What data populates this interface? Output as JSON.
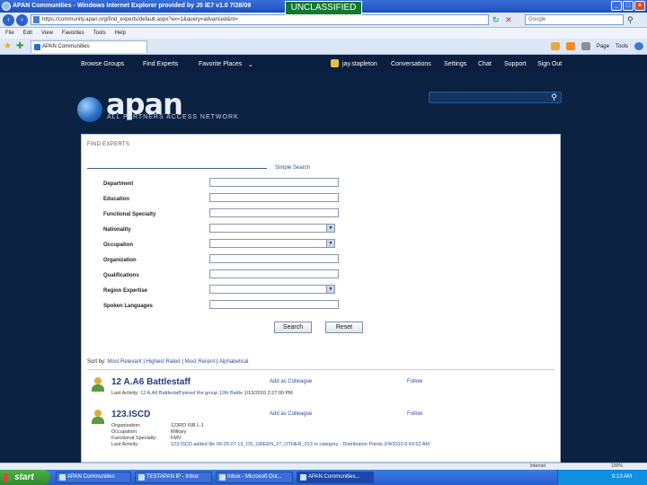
{
  "browser": {
    "title": "APAN Communities - Windows Internet Explorer provided by J5 IE7 v1.0 7/28/09",
    "classification": "UNCLASSIFIED",
    "address": "https://community.apan.org/find_experts/default.aspx?ex=1&query=advanced&nt=",
    "search_placeholder": "Google",
    "menu": [
      "File",
      "Edit",
      "View",
      "Favorites",
      "Tools",
      "Help"
    ],
    "tab_label": "APAN Communities",
    "cmd_items": [
      "Page",
      "Tools"
    ]
  },
  "site": {
    "nav": {
      "browse_groups": "Browse Groups",
      "find_experts": "Find Experts",
      "favorite_places": "Favorite Places",
      "user": "jay.stapleton",
      "conversations": "Conversations",
      "settings": "Settings",
      "chat": "Chat",
      "support": "Support",
      "sign_out": "Sign Out"
    },
    "logo": "apan",
    "logo_tagline": "ALL PARTNERS ACCESS NETWORK"
  },
  "find_experts": {
    "title": "FIND EXPERTS",
    "simple_search": "Simple Search",
    "fields": [
      {
        "label": "Department",
        "type": "text"
      },
      {
        "label": "Education",
        "type": "text"
      },
      {
        "label": "Functional Specialty",
        "type": "text"
      },
      {
        "label": "Nationality",
        "type": "select"
      },
      {
        "label": "Occupation",
        "type": "select"
      },
      {
        "label": "Organization",
        "type": "text"
      },
      {
        "label": "Qualifications",
        "type": "text"
      },
      {
        "label": "Region Expertise",
        "type": "select"
      },
      {
        "label": "Spoken Languages",
        "type": "text"
      }
    ],
    "search_button": "Search",
    "reset_button": "Reset",
    "sort": {
      "prefix": "Sort by:",
      "options": [
        "Most Relevant",
        "Highest Rated",
        "Most Recent",
        "Alphabetical"
      ]
    },
    "results": [
      {
        "name": "12 A.A6 Battlestaff",
        "add_label": "Add as Colleague",
        "follow_label": "Follow",
        "activity_prefix": "Last Activity:",
        "activity": "12 A.A6 Battlestaff joined the group 12th Battle",
        "activity_date": "1/13/2010 2:27:00 PM"
      },
      {
        "name": "123.ISCD",
        "add_label": "Add as Colleague",
        "follow_label": "Follow",
        "details": [
          {
            "k": "Organization:",
            "v": "123RD ISB L-1"
          },
          {
            "k": "Occupation:",
            "v": "Military"
          },
          {
            "k": "Functional Specialty:",
            "v": "FMV"
          },
          {
            "k": "Last Activity:",
            "v": "123.ISCD added file 06-25-07 13_OS_GREEN_27_OTHER_013 to category - Distribution Points 2/4/2010 6:43:52 AM"
          }
        ]
      }
    ]
  },
  "statusbar": {
    "zone": "Internet",
    "zoom": "100%"
  },
  "taskbar": {
    "start": "start",
    "tasks": [
      "APAN Communities",
      "TESTAPAN IP - Inbox",
      "Inbox - Microsoft Out...",
      "APAN Communities..."
    ],
    "clock": "9:13 AM"
  }
}
